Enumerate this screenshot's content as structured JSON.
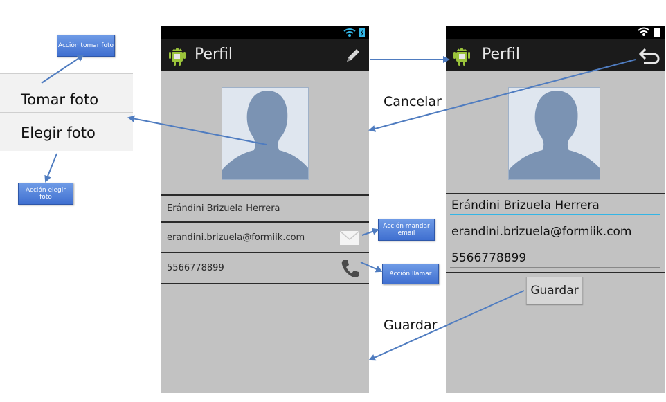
{
  "menu": {
    "items": [
      {
        "label": "Tomar foto"
      },
      {
        "label": "Elegir foto"
      }
    ]
  },
  "callouts": {
    "take_photo": "Acción tomar foto",
    "choose_photo": "Acción elegir foto",
    "send_email": "Acción mandar email",
    "call": "Acción llamar"
  },
  "view_screen": {
    "title": "Perfil",
    "name": "Erándini Brizuela Herrera",
    "email": "erandini.brizuela@formiik.com",
    "phone": "5566778899",
    "action_icon": "pencil-icon"
  },
  "edit_screen": {
    "title": "Perfil",
    "name_value": "Erándini Brizuela Herrera",
    "email_value": "erandini.brizuela@formiik.com",
    "phone_value": "5566778899",
    "save_label": "Guardar",
    "action_icon": "undo-icon"
  },
  "labels": {
    "cancel": "Cancelar",
    "save": "Guardar"
  },
  "colors": {
    "arrow": "#4f7cc0",
    "callout": "#4a78d6",
    "avatar_silhouette": "#7b93b3",
    "android_green": "#9bc43b"
  }
}
